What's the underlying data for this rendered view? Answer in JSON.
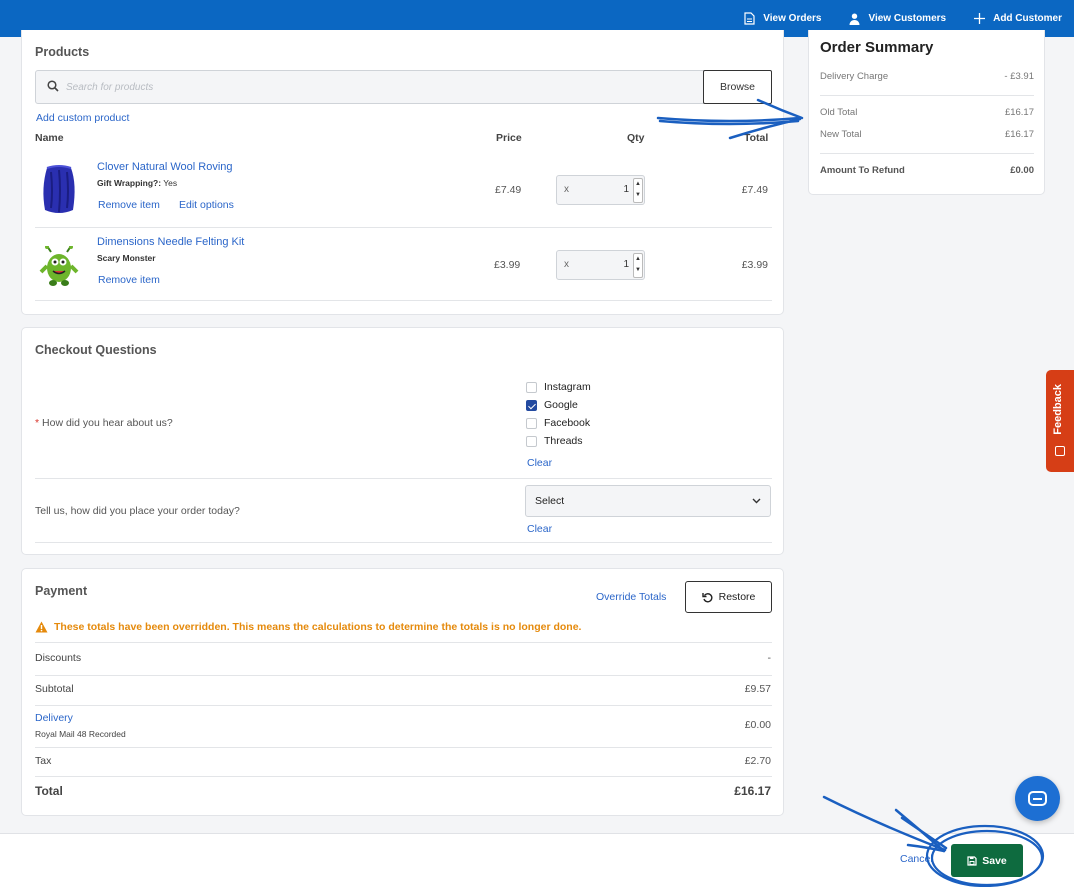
{
  "topnav": {
    "view_orders": "View Orders",
    "view_customers": "View Customers",
    "add_customer": "Add Customer"
  },
  "products": {
    "title": "Products",
    "search_placeholder": "Search for products",
    "browse_label": "Browse",
    "add_custom": "Add custom product",
    "headers": {
      "name": "Name",
      "price": "Price",
      "qty": "Qty",
      "total": "Total"
    },
    "items": [
      {
        "name": "Clover Natural Wool Roving",
        "meta_key": "Gift Wrapping?:",
        "meta_value": "Yes",
        "remove": "Remove item",
        "edit": "Edit options",
        "price": "£7.49",
        "qty_prefix": "x",
        "qty": "1",
        "total": "£7.49"
      },
      {
        "name": "Dimensions Needle Felting Kit",
        "meta_value": "Scary Monster",
        "remove": "Remove item",
        "price": "£3.99",
        "qty_prefix": "x",
        "qty": "1",
        "total": "£3.99"
      }
    ]
  },
  "checkout": {
    "title": "Checkout Questions",
    "q1_required": "*",
    "q1": "How did you hear about us?",
    "options": [
      {
        "label": "Instagram",
        "checked": false
      },
      {
        "label": "Google",
        "checked": true
      },
      {
        "label": "Facebook",
        "checked": false
      },
      {
        "label": "Threads",
        "checked": false
      }
    ],
    "clear": "Clear",
    "q2": "Tell us, how did you place your order today?",
    "q2_select": "Select",
    "clear2": "Clear"
  },
  "payment": {
    "title": "Payment",
    "override": "Override Totals",
    "restore": "Restore",
    "warning": "These totals have been overridden. This means the calculations to determine the totals is no longer done.",
    "discounts_label": "Discounts",
    "discounts_value": "-",
    "subtotal_label": "Subtotal",
    "subtotal_value": "£9.57",
    "delivery_label": "Delivery",
    "delivery_method": "Royal Mail 48 Recorded",
    "delivery_value": "£0.00",
    "tax_label": "Tax",
    "tax_value": "£2.70",
    "total_label": "Total",
    "total_value": "£16.17"
  },
  "summary": {
    "title": "Order Summary",
    "delivery_label": "Delivery Charge",
    "delivery_value": "- £3.91",
    "old_label": "Old Total",
    "old_value": "£16.17",
    "new_label": "New Total",
    "new_value": "£16.17",
    "refund_label": "Amount To Refund",
    "refund_value": "£0.00"
  },
  "feedback": "Feedback",
  "footer": {
    "cancel": "Cancel",
    "save": "Save"
  },
  "colors": {
    "topbar": "#0b67c2",
    "save": "#0e6b3f",
    "feedback": "#d63e16",
    "warning": "#e58a0c",
    "link": "#2b66c9",
    "annotation": "#1a5fc0"
  }
}
